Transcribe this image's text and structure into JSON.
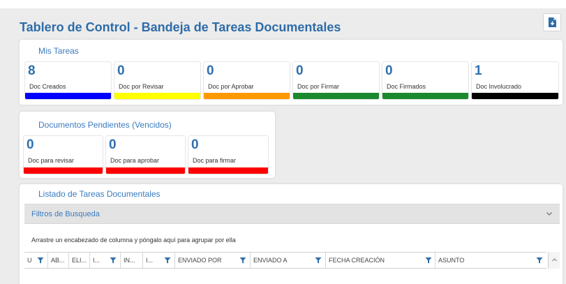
{
  "header": {
    "title": "Tablero de Control - Bandeja de Tareas Documentales",
    "export_icon": "file-download-icon"
  },
  "mis_tareas": {
    "title": "Mis Tareas",
    "tiles": [
      {
        "value": "8",
        "label": "Doc Creados",
        "color": "#0000ff"
      },
      {
        "value": "0",
        "label": "Doc por Revisar",
        "color": "#ffff00"
      },
      {
        "value": "0",
        "label": "Doc por Aprobar",
        "color": "#ff9900"
      },
      {
        "value": "0",
        "label": "Doc por Firmar",
        "color": "#1b8a2e"
      },
      {
        "value": "0",
        "label": "Doc Firmados",
        "color": "#1b8a2e"
      },
      {
        "value": "1",
        "label": "Doc Involucrado",
        "color": "#000000"
      }
    ]
  },
  "pendientes": {
    "title": "Documentos Pendientes (Vencidos)",
    "tiles": [
      {
        "value": "0",
        "label": "Doc para revisar",
        "color": "#ff0000"
      },
      {
        "value": "0",
        "label": "Doc para aprobar",
        "color": "#ff0000"
      },
      {
        "value": "0",
        "label": "Doc para firmar",
        "color": "#ff0000"
      }
    ]
  },
  "listado": {
    "title": "Listado de Tareas Documentales",
    "filters_label": "Filtros de Busqueda",
    "group_hint": "Arrastre un encabezado de columna y póngalo aquí para agrupar por ella",
    "columns": [
      {
        "label": "U"
      },
      {
        "label": "AB..."
      },
      {
        "label": "ELI..."
      },
      {
        "label": "I..."
      },
      {
        "label": "IN..."
      },
      {
        "label": "I..."
      },
      {
        "label": "ENVIADO POR"
      },
      {
        "label": "ENVIADO A"
      },
      {
        "label": "FECHA CREACIÓN"
      },
      {
        "label": "ASUNTO"
      }
    ]
  }
}
